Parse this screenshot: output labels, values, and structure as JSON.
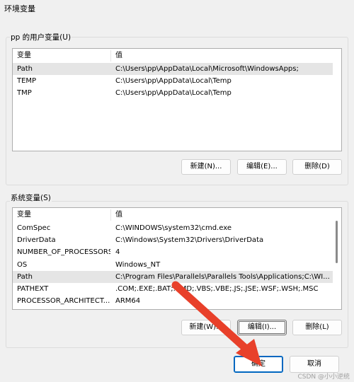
{
  "window": {
    "title": "环境变量"
  },
  "user_vars": {
    "group_label": "pp 的用户变量(U)",
    "columns": [
      "变量",
      "值"
    ],
    "rows": [
      {
        "name": "Path",
        "value": "C:\\Users\\pp\\AppData\\Local\\Microsoft\\WindowsApps;",
        "selected": true
      },
      {
        "name": "TEMP",
        "value": "C:\\Users\\pp\\AppData\\Local\\Temp",
        "selected": false
      },
      {
        "name": "TMP",
        "value": "C:\\Users\\pp\\AppData\\Local\\Temp",
        "selected": false
      }
    ],
    "buttons": {
      "new": "新建(N)...",
      "edit": "编辑(E)...",
      "delete": "删除(D)"
    }
  },
  "system_vars": {
    "group_label": "系统变量(S)",
    "columns": [
      "变量",
      "值"
    ],
    "rows": [
      {
        "name": "ComSpec",
        "value": "C:\\WINDOWS\\system32\\cmd.exe",
        "selected": false
      },
      {
        "name": "DriverData",
        "value": "C:\\Windows\\System32\\Drivers\\DriverData",
        "selected": false
      },
      {
        "name": "NUMBER_OF_PROCESSORS",
        "value": "4",
        "selected": false
      },
      {
        "name": "OS",
        "value": "Windows_NT",
        "selected": false
      },
      {
        "name": "Path",
        "value": "C:\\Program Files\\Parallels\\Parallels Tools\\Applications;C:\\WI...",
        "selected": true
      },
      {
        "name": "PATHEXT",
        "value": ".COM;.EXE;.BAT;.CMD;.VBS;.VBE;.JS;.JSE;.WSF;.WSH;.MSC",
        "selected": false
      },
      {
        "name": "PROCESSOR_ARCHITECT...",
        "value": "ARM64",
        "selected": false
      }
    ],
    "buttons": {
      "new": "新建(W)...",
      "edit": "编辑(I)...",
      "delete": "删除(L)"
    }
  },
  "footer": {
    "ok": "确定",
    "cancel": "取消",
    "watermark": "CSDN @小小逆统"
  },
  "colors": {
    "selected_row": "#e5e5e5",
    "arrow": "#e8402a",
    "primary_border": "#0067c0"
  }
}
